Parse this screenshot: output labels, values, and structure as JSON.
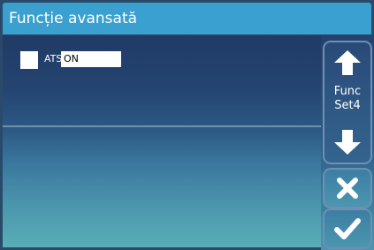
{
  "title": "Funcție avansată",
  "options": {
    "ats_label": "ATS",
    "ats_value": "ON"
  },
  "nav": {
    "func_line1": "Func",
    "func_line2": "Set4"
  },
  "icons": {
    "up": "arrow-up-icon",
    "down": "arrow-down-icon",
    "cancel": "close-icon",
    "confirm": "checkmark-icon"
  },
  "colors": {
    "title_bar": "#3aa0cf",
    "panel_top": "#223a66",
    "panel_bottom": "#58aeb6"
  }
}
